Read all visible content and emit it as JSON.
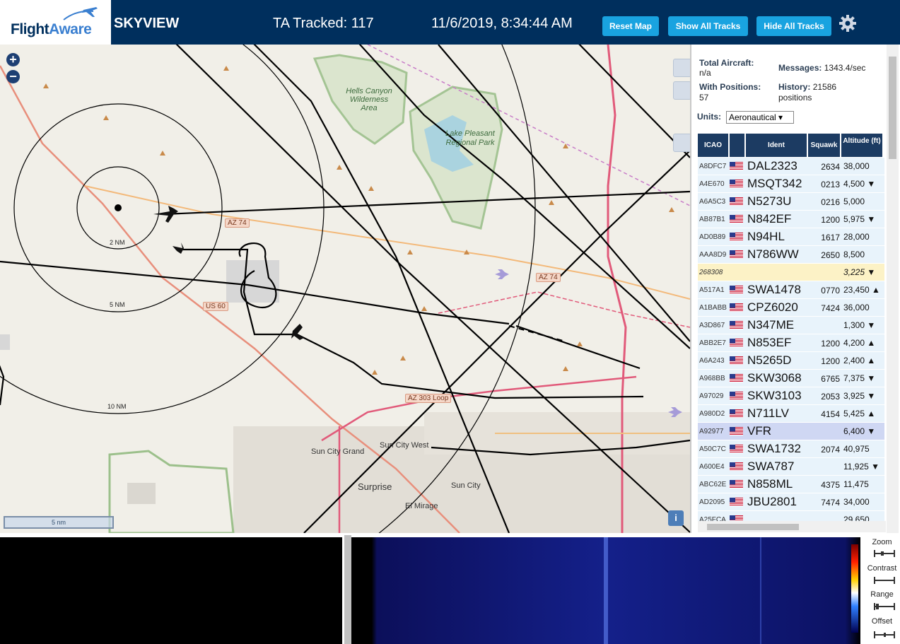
{
  "header": {
    "logo_text_a": "Flight",
    "logo_text_b": "Aware",
    "app_title": "SKYVIEW",
    "tracked_label": "TA Tracked: 117",
    "datetime": "11/6/2019, 8:34:44 AM",
    "reset_map": "Reset Map",
    "show_all_tracks": "Show All Tracks",
    "hide_all_tracks": "Hide All Tracks"
  },
  "map": {
    "labels": {
      "hells_canyon": "Hells Canyon Wilderness Area",
      "lake_pleasant": "Lake Pleasant Regional Park",
      "sun_city_grand": "Sun City Grand",
      "sun_city_west": "Sun City West",
      "surprise": "Surprise",
      "sun_city": "Sun City",
      "el_mirage": "El Mirage"
    },
    "shields": {
      "az74a": "AZ 74",
      "az74b": "AZ 74",
      "us60": "US 60",
      "az303": "AZ 303 Loop"
    },
    "rings": {
      "r2": "2 NM",
      "r5": "5 NM",
      "r10": "10 NM"
    },
    "scale": "5 nm",
    "info": "i"
  },
  "stats": {
    "total_aircraft_label": "Total Aircraft:",
    "total_aircraft_value": "n/a",
    "with_positions_label": "With Positions:",
    "with_positions_value": "57",
    "messages_label": "Messages:",
    "messages_value": "1343.4/sec",
    "history_label": "History:",
    "history_value": "21586",
    "history_unit": "positions",
    "units_label": "Units:",
    "units_value": "Aeronautical"
  },
  "table": {
    "headers": {
      "icao": "ICAO",
      "ident": "Ident",
      "squawk": "Squawk",
      "altitude": "Altitude (ft)"
    },
    "rows": [
      {
        "icao": "A8DFC7",
        "ident": "DAL2323",
        "squawk": "2634",
        "altitude": "38,000",
        "flag": true
      },
      {
        "icao": "A4E670",
        "ident": "MSQT342",
        "squawk": "0213",
        "altitude": "4,500 ▼",
        "flag": true
      },
      {
        "icao": "A6A5C3",
        "ident": "N5273U",
        "squawk": "0216",
        "altitude": "5,000",
        "flag": true
      },
      {
        "icao": "AB87B1",
        "ident": "N842EF",
        "squawk": "1200",
        "altitude": "5,975 ▼",
        "flag": true
      },
      {
        "icao": "AD0B89",
        "ident": "N94HL",
        "squawk": "1617",
        "altitude": "28,000",
        "flag": true
      },
      {
        "icao": "AAA8D9",
        "ident": "N786WW",
        "squawk": "2650",
        "altitude": "8,500",
        "flag": true
      },
      {
        "icao": "268308",
        "ident": "",
        "squawk": "",
        "altitude": "3,225 ▼",
        "flag": false
      },
      {
        "icao": "A517A1",
        "ident": "SWA1478",
        "squawk": "0770",
        "altitude": "23,450 ▲",
        "flag": true
      },
      {
        "icao": "A1BABB",
        "ident": "CPZ6020",
        "squawk": "7424",
        "altitude": "36,000",
        "flag": true
      },
      {
        "icao": "A3D867",
        "ident": "N347ME",
        "squawk": "",
        "altitude": "1,300 ▼",
        "flag": true
      },
      {
        "icao": "ABB2E7",
        "ident": "N853EF",
        "squawk": "1200",
        "altitude": "4,200 ▲",
        "flag": true
      },
      {
        "icao": "A6A243",
        "ident": "N5265D",
        "squawk": "1200",
        "altitude": "2,400 ▲",
        "flag": true
      },
      {
        "icao": "A968BB",
        "ident": "SKW3068",
        "squawk": "6765",
        "altitude": "7,375 ▼",
        "flag": true
      },
      {
        "icao": "A97029",
        "ident": "SKW3103",
        "squawk": "2053",
        "altitude": "3,925 ▼",
        "flag": true
      },
      {
        "icao": "A980D2",
        "ident": "N711LV",
        "squawk": "4154",
        "altitude": "5,425 ▲",
        "flag": true
      },
      {
        "icao": "A92977",
        "ident": "VFR",
        "squawk": "",
        "altitude": "6,400 ▼",
        "flag": true
      },
      {
        "icao": "A50C7C",
        "ident": "SWA1732",
        "squawk": "2074",
        "altitude": "40,975",
        "flag": true
      },
      {
        "icao": "A600E4",
        "ident": "SWA787",
        "squawk": "",
        "altitude": "11,925 ▼",
        "flag": true
      },
      {
        "icao": "ABC62E",
        "ident": "N858ML",
        "squawk": "4375",
        "altitude": "11,475",
        "flag": true
      },
      {
        "icao": "AD2095",
        "ident": "JBU2801",
        "squawk": "7474",
        "altitude": "34,000",
        "flag": true
      },
      {
        "icao": "A25FCA",
        "ident": "",
        "squawk": "",
        "altitude": "29,650",
        "flag": true
      }
    ]
  },
  "spectrum": {
    "zoom": "Zoom",
    "contrast": "Contrast",
    "range": "Range",
    "offset": "Offset"
  }
}
